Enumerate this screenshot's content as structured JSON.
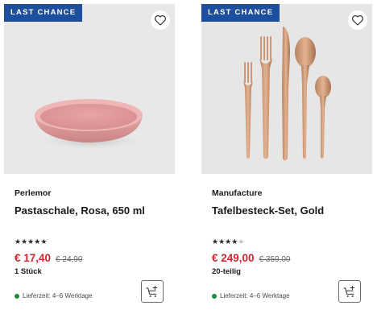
{
  "products": [
    {
      "badge": "LAST CHANCE",
      "brand": "Perlemor",
      "title": "Pastaschale, Rosa, 650 ml",
      "rating": {
        "value": 5,
        "max": 5
      },
      "price": "€ 17,40",
      "old_price": "€ 24,90",
      "unit": "1 Stück",
      "delivery": "Lieferzeit: 4–6 Werktage",
      "icons": {
        "wishlist": "heart-outline-icon",
        "cart": "add-to-cart-icon"
      }
    },
    {
      "badge": "LAST CHANCE",
      "brand": "Manufacture",
      "title": "Tafelbesteck-Set, Gold",
      "rating": {
        "value": 4,
        "max": 5
      },
      "price": "€ 249,00",
      "old_price": "€ 359,00",
      "unit": "20-teilig",
      "delivery": "Lieferzeit: 4–6 Werktage",
      "icons": {
        "wishlist": "heart-outline-icon",
        "cart": "add-to-cart-icon"
      }
    }
  ],
  "colors": {
    "badge_bg": "#1e4f9c",
    "price": "#d0262e",
    "in_stock_dot": "#1f8a3a"
  }
}
